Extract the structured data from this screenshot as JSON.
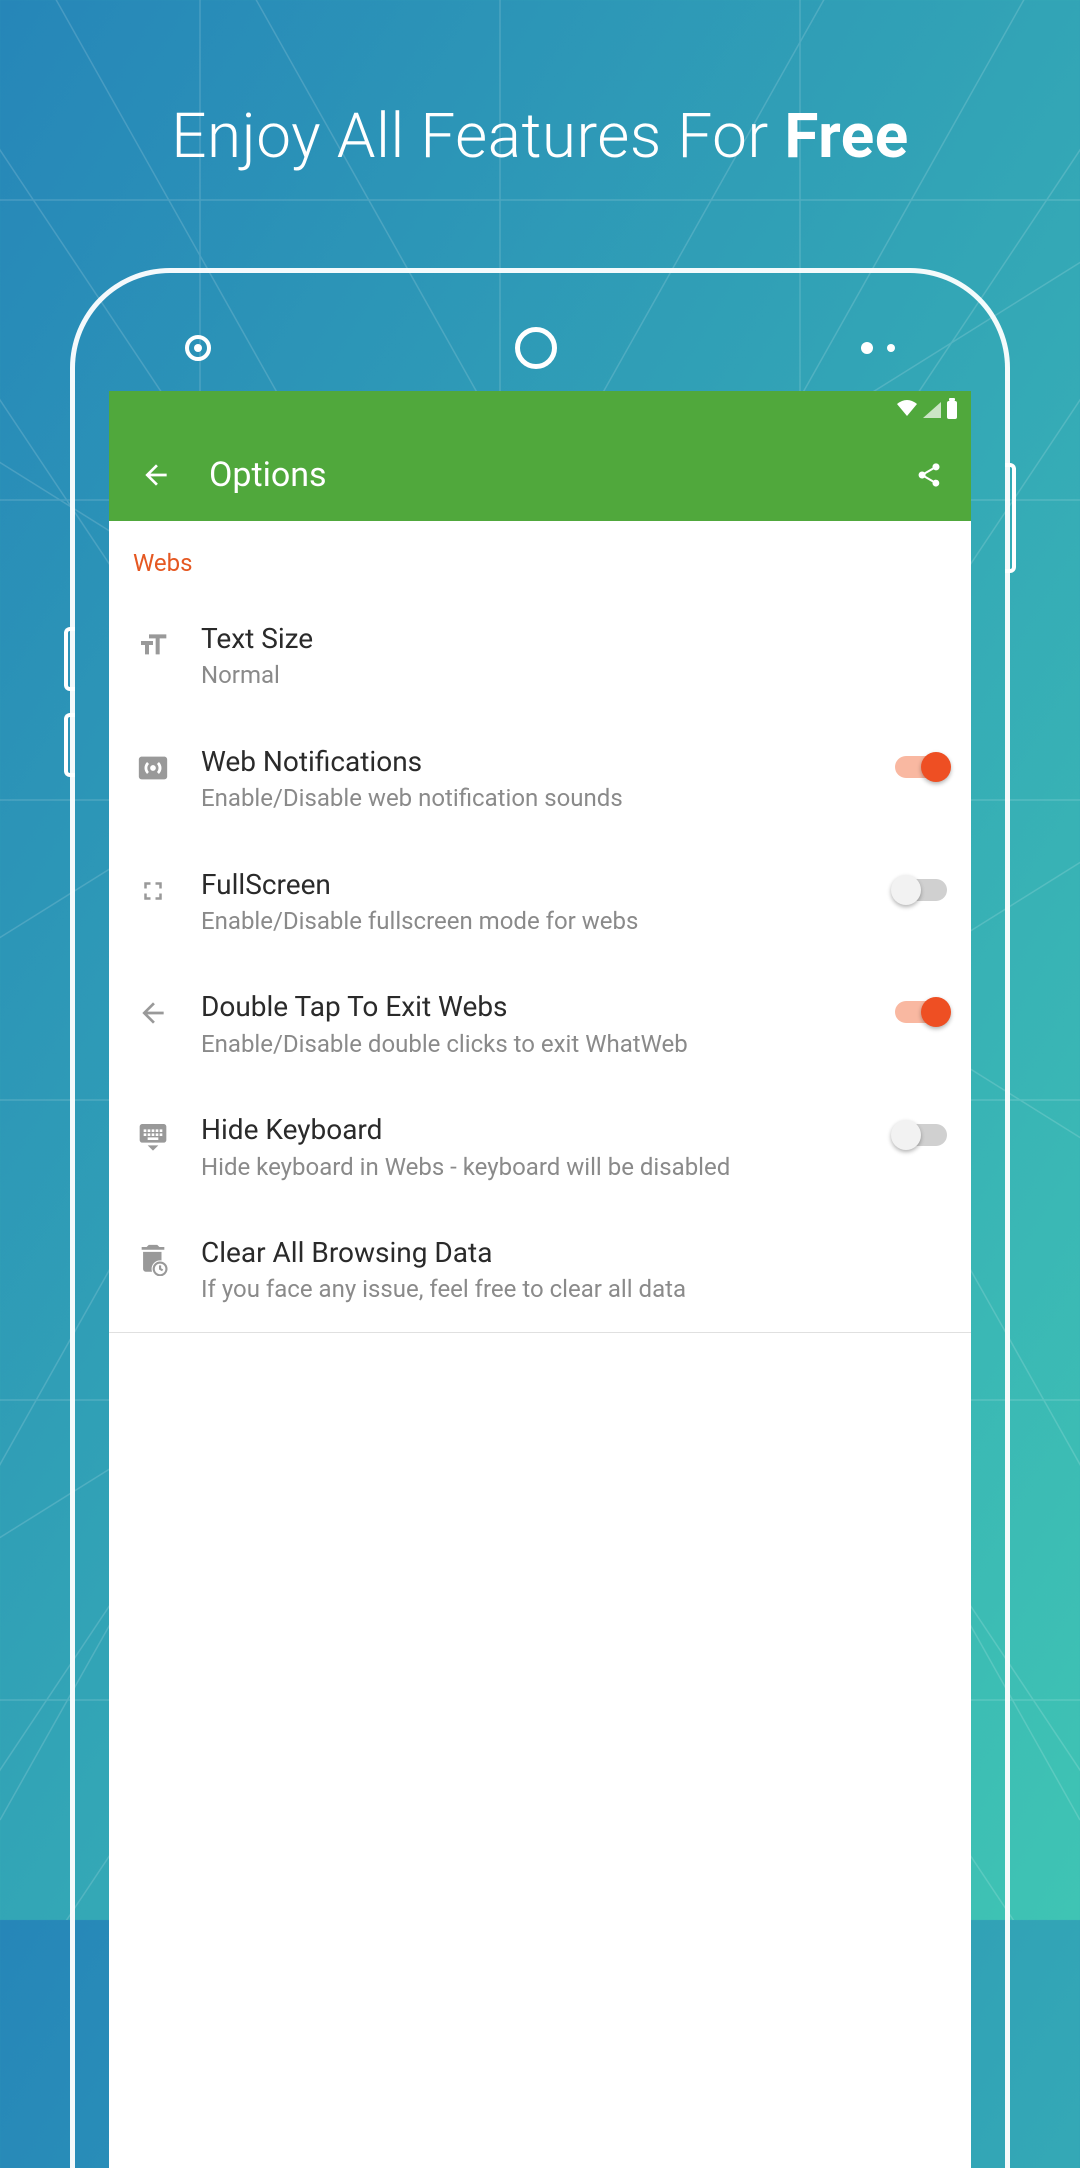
{
  "hero": {
    "prefix": "Enjoy All Features For ",
    "bold": "Free"
  },
  "appbar": {
    "title": "Options"
  },
  "section": {
    "label": "Webs"
  },
  "rows": {
    "textSize": {
      "title": "Text Size",
      "sub": "Normal"
    },
    "webNotif": {
      "title": "Web Notifications",
      "sub": "Enable/Disable web notification sounds",
      "on": true
    },
    "fullscreen": {
      "title": "FullScreen",
      "sub": "Enable/Disable fullscreen mode for webs",
      "on": false
    },
    "doubleTap": {
      "title": "Double Tap To Exit Webs",
      "sub": "Enable/Disable double clicks to exit WhatWeb",
      "on": true
    },
    "hideKb": {
      "title": "Hide Keyboard",
      "sub": "Hide keyboard in Webs - keyboard will be disabled",
      "on": false
    },
    "clearData": {
      "title": "Clear All Browsing Data",
      "sub": "If you face any issue, feel free to clear all data"
    }
  }
}
